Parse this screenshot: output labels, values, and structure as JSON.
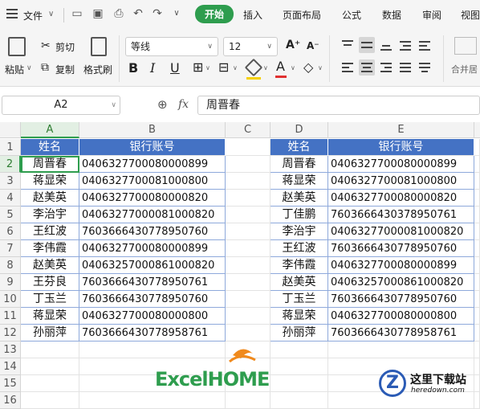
{
  "menubar": {
    "file_label": "文件",
    "tabs": [
      "开始",
      "插入",
      "页面布局",
      "公式",
      "数据",
      "审阅",
      "视图"
    ]
  },
  "ribbon": {
    "paste_label": "粘贴",
    "cut_label": "剪切",
    "copy_label": "复制",
    "format_painter_label": "格式刷",
    "font_name": "等线",
    "font_size": "12",
    "merge_label": "合并居"
  },
  "formula_bar": {
    "cell_ref": "A2",
    "fx_label": "fx",
    "content": "周晋春"
  },
  "columns": [
    "A",
    "B",
    "C",
    "D",
    "E"
  ],
  "rows": [
    "1",
    "2",
    "3",
    "4",
    "5",
    "6",
    "7",
    "8",
    "9",
    "10",
    "11",
    "12",
    "13",
    "14",
    "15",
    "16"
  ],
  "left_table": {
    "headers": [
      "姓名",
      "银行账号"
    ],
    "rows": [
      [
        "周晋春",
        "0406327700080000899"
      ],
      [
        "蒋显荣",
        "0406327700081000800"
      ],
      [
        "赵美英",
        "0406327700080000820"
      ],
      [
        "李治宇",
        "04063277000081000820"
      ],
      [
        "王红波",
        "7603666430778950760"
      ],
      [
        "李伟霞",
        "0406327700080000899"
      ],
      [
        "赵美英",
        "0406325700086100082​0"
      ],
      [
        "王芬良",
        "7603666430778950761"
      ],
      [
        "丁玉兰",
        "7603666430778950760"
      ],
      [
        "蒋显荣",
        "0406327700080000800"
      ],
      [
        "孙丽萍",
        "7603666430778958761"
      ]
    ]
  },
  "right_table": {
    "headers": [
      "姓名",
      "银行账号"
    ],
    "rows": [
      [
        "周晋春",
        "0406327700080000899"
      ],
      [
        "蒋显荣",
        "0406327700081000800"
      ],
      [
        "赵美英",
        "0406327700080000820"
      ],
      [
        "丁佳鹏",
        "7603666430378950761"
      ],
      [
        "李治宇",
        "04063277000081000820"
      ],
      [
        "王红波",
        "7603666430778950760"
      ],
      [
        "李伟霞",
        "0406327700080000899"
      ],
      [
        "赵美英",
        "04063257000861000820"
      ],
      [
        "丁玉兰",
        "7603666430778950760"
      ],
      [
        "蒋显荣",
        "0406327700080000800"
      ],
      [
        "孙丽萍",
        "7603666430778958761"
      ]
    ]
  },
  "watermarks": {
    "excelhome": "ExcelHOME",
    "site_name": "这里下载站",
    "site_url": "heredown.com"
  },
  "colors": {
    "accent_green": "#2e9d4e",
    "header_blue": "#4472c4"
  }
}
